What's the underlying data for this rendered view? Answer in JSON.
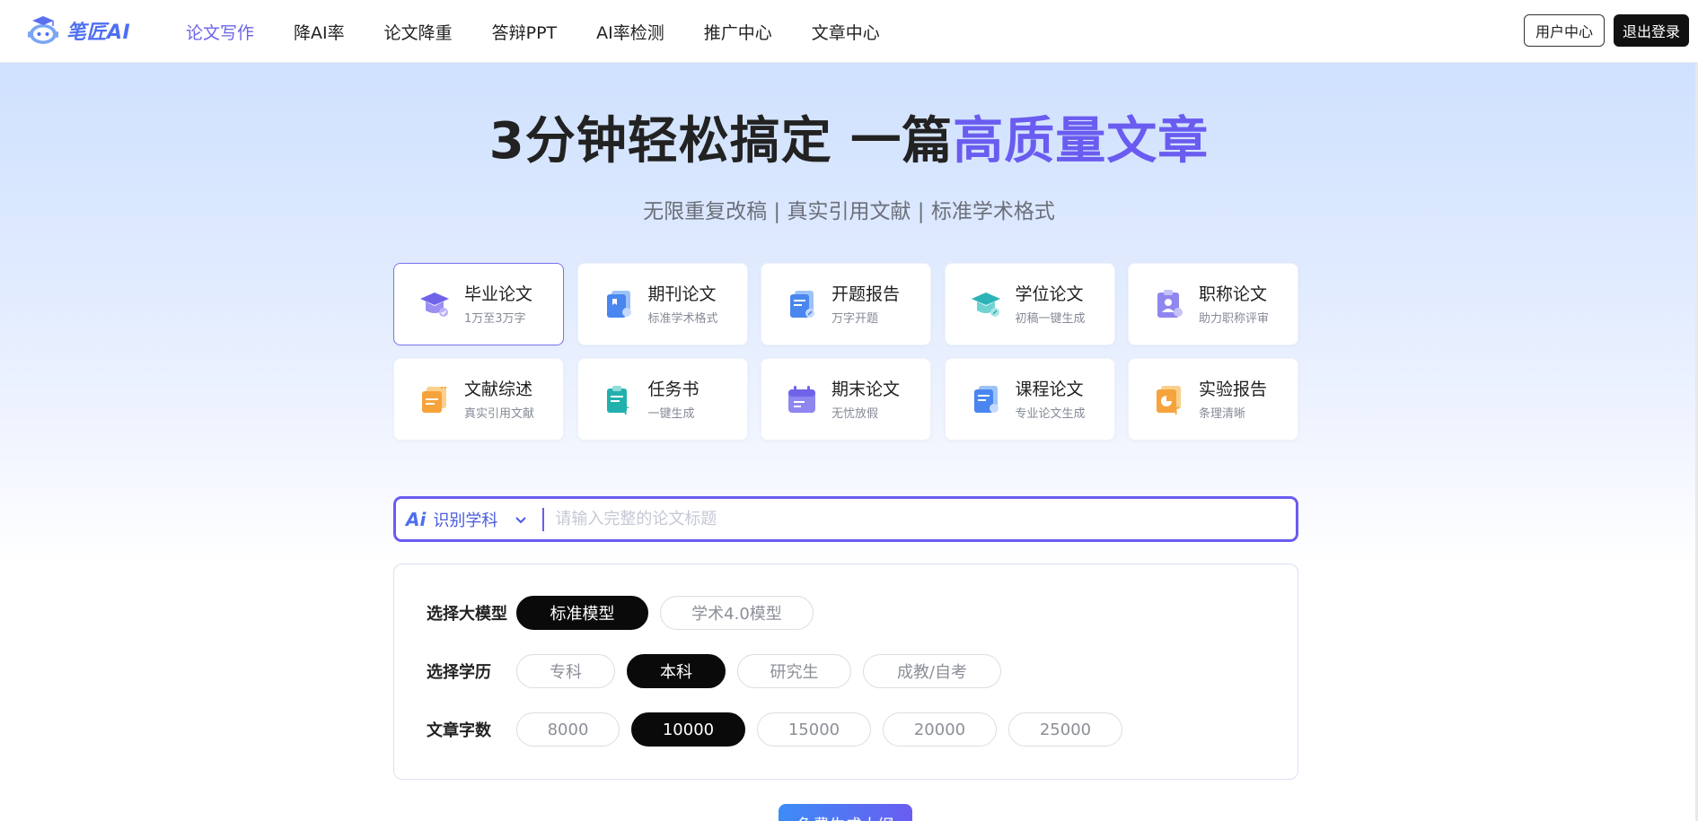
{
  "brand": {
    "name": "笔匠AI"
  },
  "nav": {
    "items": [
      {
        "label": "论文写作",
        "active": true
      },
      {
        "label": "降AI率",
        "active": false
      },
      {
        "label": "论文降重",
        "active": false
      },
      {
        "label": "答辩PPT",
        "active": false
      },
      {
        "label": "AI率检测",
        "active": false
      },
      {
        "label": "推广中心",
        "active": false
      },
      {
        "label": "文章中心",
        "active": false
      }
    ]
  },
  "header": {
    "user_center": "用户中心",
    "logout": "退出登录"
  },
  "hero": {
    "title_main": "3分钟轻松搞定 一篇",
    "title_highlight": "高质量文章",
    "subtitle": "无限重复改稿 | 真实引用文献 | 标准学术格式"
  },
  "cards": [
    {
      "name": "毕业论文",
      "sub": "1万至3万字",
      "icon": "graduation-cap-icon",
      "active": true
    },
    {
      "name": "期刊论文",
      "sub": "标准学术格式",
      "icon": "journal-icon"
    },
    {
      "name": "开题报告",
      "sub": "万字开题",
      "icon": "proposal-icon"
    },
    {
      "name": "学位论文",
      "sub": "初稿一键生成",
      "icon": "degree-cap-icon"
    },
    {
      "name": "职称论文",
      "sub": "助力职称评审",
      "icon": "title-badge-icon"
    },
    {
      "name": "文献综述",
      "sub": "真实引用文献",
      "icon": "literature-icon"
    },
    {
      "name": "任务书",
      "sub": "一键生成",
      "icon": "task-clipboard-icon"
    },
    {
      "name": "期末论文",
      "sub": "无忧放假",
      "icon": "calendar-icon"
    },
    {
      "name": "课程论文",
      "sub": "专业论文生成",
      "icon": "course-doc-icon"
    },
    {
      "name": "实验报告",
      "sub": "条理清晰",
      "icon": "lab-report-icon"
    }
  ],
  "search": {
    "ai_badge": "Ai",
    "subject_label": "识别学科",
    "placeholder": "请输入完整的论文标题",
    "value": ""
  },
  "options": {
    "model": {
      "label": "选择大模型",
      "choices": [
        "标准模型",
        "学术4.0模型"
      ],
      "selected": "标准模型"
    },
    "degree": {
      "label": "选择学历",
      "choices": [
        "专科",
        "本科",
        "研究生",
        "成教/自考"
      ],
      "selected": "本科"
    },
    "words": {
      "label": "文章字数",
      "choices": [
        "8000",
        "10000",
        "15000",
        "20000",
        "25000"
      ],
      "selected": "10000"
    }
  },
  "generate": {
    "label": "免费生成大纲"
  },
  "colors": {
    "accent": "#6a5cf0",
    "brand_blue": "#4f6ff0",
    "selected_chip": "#0a0a0a"
  }
}
